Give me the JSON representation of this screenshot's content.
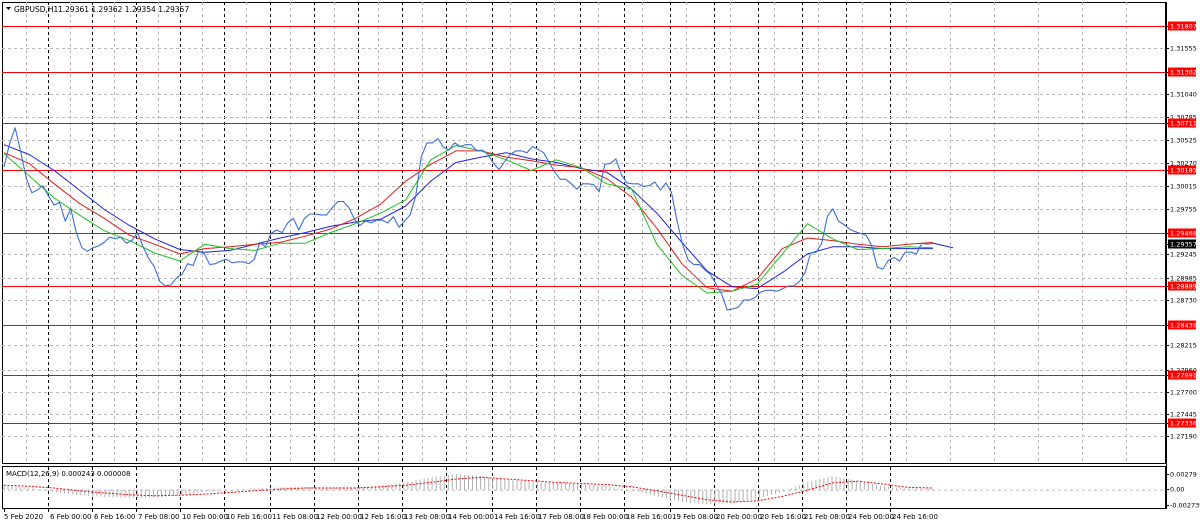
{
  "header": {
    "symbol_label": "GBPUSD,H1",
    "ohlc": "1.29361 1.29362 1.29354 1.29357",
    "indicator_label": "MACD(12,26,9) 0.000243 0.000008"
  },
  "colors": {
    "background": "#ffffff",
    "price_line": "#3d6fd6",
    "ma_fast": "#22c022",
    "ma_mid": "#e02020",
    "ma_slow": "#2020e0",
    "level": "#ff0000",
    "grid": "#b8b8b8",
    "macd_hist": "#b0b0b0",
    "macd_signal": "#ff0000",
    "current_price_bg": "#000000"
  },
  "chart_data": [
    {
      "type": "line",
      "title": "GBPUSD,H1",
      "ylim": [
        1.27,
        1.32
      ],
      "y_ticks": [
        "1.31807",
        "1.31555",
        "1.31302",
        "1.31040",
        "1.30785",
        "1.30711",
        "1.30525",
        "1.30270",
        "1.30185",
        "1.30015",
        "1.29755",
        "1.29468",
        "1.29357",
        "1.29245",
        "1.28985",
        "1.28889",
        "1.28730",
        "1.28439",
        "1.28215",
        "1.27960",
        "1.27891",
        "1.27700",
        "1.27445",
        "1.27336",
        "1.27190"
      ],
      "x_tick_labels": [
        "5 Feb 2020",
        "6 Feb 00:00",
        "6 Feb 16:00",
        "7 Feb 08:00",
        "10 Feb 00:00",
        "10 Feb 16:00",
        "11 Feb 08:00",
        "12 Feb 00:00",
        "12 Feb 16:00",
        "13 Feb 08:00",
        "14 Feb 00:00",
        "14 Feb 16:00",
        "17 Feb 08:00",
        "18 Feb 00:00",
        "18 Feb 16:00",
        "19 Feb 08:00",
        "20 Feb 00:00",
        "20 Feb 16:00",
        "21 Feb 08:00",
        "24 Feb 00:00",
        "24 Feb 16:00"
      ],
      "levels": [
        "1.31807",
        "1.31302",
        "1.30711",
        "1.30185",
        "1.29468",
        "1.28889",
        "1.28439",
        "1.27891",
        "1.27336"
      ],
      "current_price": "1.29357",
      "grid": true,
      "series": [
        {
          "values": [
            1.3022,
            1.3048,
            1.3066,
            1.3039,
            1.3009,
            1.2993,
            1.2996,
            1.3001,
            1.2989,
            1.2979,
            1.2982,
            1.2961,
            1.2975,
            1.2948,
            1.2931,
            1.2927,
            1.2931,
            1.2933,
            1.2937,
            1.2943,
            1.2941,
            1.2943,
            1.2936,
            1.2939,
            1.2948,
            1.2932,
            1.2919,
            1.291,
            1.2893,
            1.2888,
            1.2889,
            1.2897,
            1.2901,
            1.2913,
            1.2911,
            1.2927,
            1.2924,
            1.2912,
            1.2913,
            1.2916,
            1.2918,
            1.2914,
            1.2915,
            1.2915,
            1.2913,
            1.2918,
            1.2937,
            1.2932,
            1.2947,
            1.2951,
            1.2948,
            1.2959,
            1.2964,
            1.2951,
            1.2964,
            1.2969,
            1.2969,
            1.2968,
            1.2968,
            1.2976,
            1.2983,
            1.2983,
            1.2976,
            1.2963,
            1.2956,
            1.2961,
            1.2959,
            1.2962,
            1.2962,
            1.2959,
            1.2966,
            1.2954,
            1.2961,
            1.2968,
            1.2989,
            1.3033,
            1.3049,
            1.3049,
            1.3054,
            1.3044,
            1.3041,
            1.3049,
            1.3045,
            1.3047,
            1.3047,
            1.304,
            1.3041,
            1.3036,
            1.3026,
            1.3019,
            1.3028,
            1.3036,
            1.304,
            1.304,
            1.3038,
            1.3045,
            1.3042,
            1.3038,
            1.3027,
            1.3016,
            1.3008,
            1.3008,
            1.3003,
            1.2997,
            1.3003,
            1.3003,
            1.3002,
            1.2994,
            1.3025,
            1.3026,
            1.3031,
            1.3013,
            1.3004,
            1.3003,
            1.3003,
            1.3,
            1.3001,
            1.3005,
            1.2996,
            1.3004,
            1.2993,
            1.2961,
            1.2934,
            1.2917,
            1.2912,
            1.2912,
            1.2906,
            1.2901,
            1.289,
            1.2879,
            1.2861,
            1.2862,
            1.2864,
            1.2872,
            1.2872,
            1.2875,
            1.2881,
            1.2883,
            1.2883,
            1.2882,
            1.2885,
            1.2888,
            1.2888,
            1.2893,
            1.2903,
            1.2925,
            1.2926,
            1.2936,
            1.2966,
            1.2975,
            1.2961,
            1.2957,
            1.2952,
            1.2949,
            1.2947,
            1.2945,
            1.2933,
            1.2909,
            1.2907,
            1.2917,
            1.292,
            1.2916,
            1.2926,
            1.2926,
            1.2924,
            1.2936,
            1.2935,
            1.2936
          ]
        },
        {
          "name": "",
          "values": [
            1.3037,
            1.3012,
            1.2987,
            1.2968,
            1.295,
            1.2939,
            1.2925,
            1.2916,
            1.2935,
            1.293,
            1.2928,
            1.2936,
            1.2936,
            1.2948,
            1.2958,
            1.297,
            1.2985,
            1.303,
            1.3046,
            1.304,
            1.303,
            1.3018,
            1.303,
            1.3021,
            1.3003,
            1.2997,
            1.2935,
            1.29,
            1.288,
            1.2882,
            1.289,
            1.2924,
            1.2958,
            1.2941,
            1.2929,
            1.293,
            1.2932,
            1.2931
          ]
        },
        {
          "name": "",
          "values": [
            1.3038,
            1.3026,
            1.3003,
            1.2981,
            1.2964,
            1.2945,
            1.2935,
            1.2924,
            1.293,
            1.2932,
            1.2935,
            1.2937,
            1.2944,
            1.2952,
            1.2964,
            1.298,
            1.3006,
            1.3025,
            1.304,
            1.304,
            1.3033,
            1.3029,
            1.3024,
            1.3021,
            1.3009,
            1.2988,
            1.2953,
            1.2913,
            1.2886,
            1.2882,
            1.2896,
            1.293,
            1.2942,
            1.2939,
            1.2935,
            1.2932,
            1.2935,
            1.2937
          ]
        },
        {
          "name": "",
          "values": [
            1.3047,
            1.3036,
            1.3018,
            1.2996,
            1.2974,
            1.2956,
            1.2941,
            1.2929,
            1.2926,
            1.2928,
            1.2935,
            1.2942,
            1.2948,
            1.2955,
            1.296,
            1.2963,
            1.2978,
            1.3006,
            1.3027,
            1.3033,
            1.3038,
            1.3031,
            1.3027,
            1.302,
            1.3016,
            1.2997,
            1.297,
            1.2937,
            1.2905,
            1.2887,
            1.2885,
            1.2903,
            1.2924,
            1.2932,
            1.2932,
            1.293,
            1.293,
            1.293
          ]
        }
      ]
    },
    {
      "type": "bar",
      "title": "MACD(12,26,9)",
      "ylim": [
        -0.002739,
        0.00279
      ],
      "y_ticks": [
        "0.00279",
        "0.00",
        "-0.002739"
      ],
      "series": [
        {
          "name": "MACD",
          "values": [
            0.0008,
            0.0003,
            -0.0004,
            -0.001,
            -0.0013,
            -0.0015,
            -0.0014,
            -0.001,
            -0.0004,
            0.0,
            0.0002,
            0.0004,
            0.0005,
            0.0004,
            0.0004,
            0.0007,
            0.0013,
            0.0022,
            0.0028,
            0.0024,
            0.0018,
            0.0014,
            0.0012,
            0.001,
            0.0006,
            -0.0001,
            -0.0012,
            -0.0022,
            -0.0026,
            -0.0024,
            -0.0016,
            -0.0004,
            0.0014,
            0.0024,
            0.0016,
            0.0006,
            0.0002,
            0.0002
          ]
        },
        {
          "name": "Signal",
          "values": [
            0.0008,
            0.0006,
            0.0003,
            -0.0002,
            -0.0006,
            -0.0009,
            -0.0011,
            -0.001,
            -0.0008,
            -0.0005,
            -0.0002,
            0.0001,
            0.0003,
            0.0003,
            0.0003,
            0.0005,
            0.0008,
            0.0013,
            0.0019,
            0.0022,
            0.0019,
            0.0016,
            0.0013,
            0.0011,
            0.0009,
            0.0005,
            -0.0002,
            -0.001,
            -0.0018,
            -0.0022,
            -0.002,
            -0.0012,
            -0.0001,
            0.0012,
            0.0015,
            0.001,
            0.0004,
            0.0003
          ]
        }
      ]
    }
  ]
}
